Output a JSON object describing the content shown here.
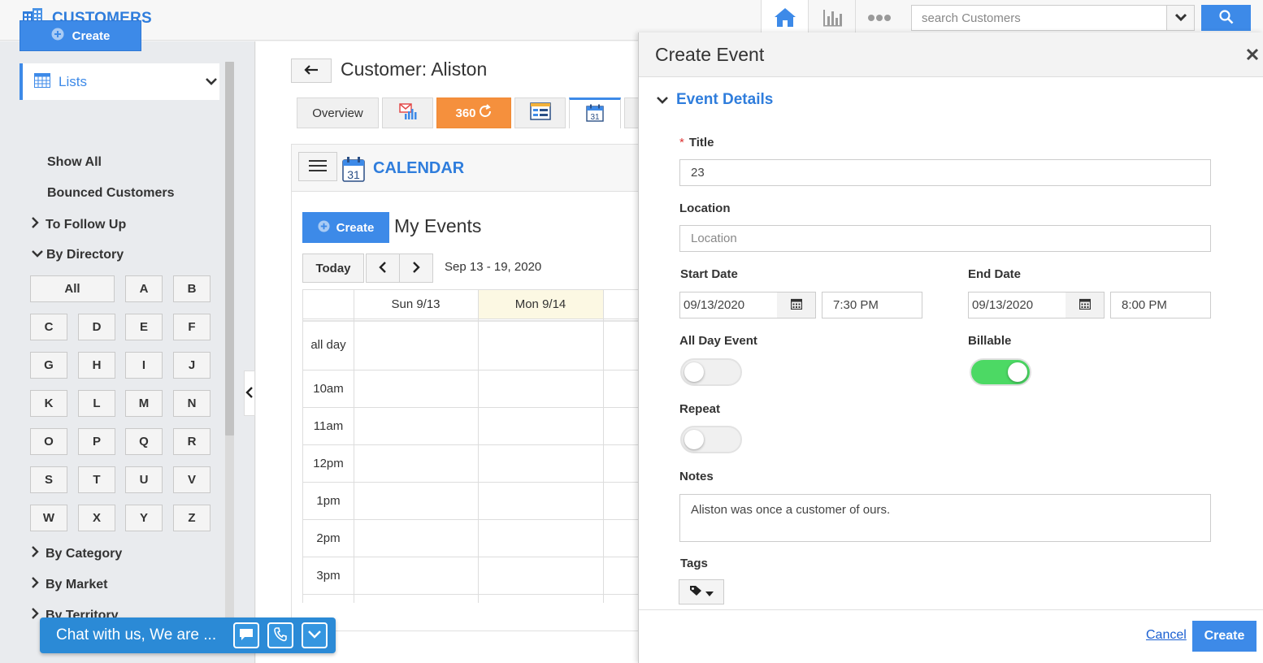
{
  "header": {
    "brand_title": "CUSTOMERS",
    "search_placeholder": "search Customers"
  },
  "sidebar": {
    "create_label": "Create",
    "lists_label": "Lists",
    "items": [
      "Show All",
      "Bounced Customers"
    ],
    "to_follow_up": "To Follow Up",
    "by_directory": "By Directory",
    "letters": [
      "All",
      "A",
      "B",
      "C",
      "D",
      "E",
      "F",
      "G",
      "H",
      "I",
      "J",
      "K",
      "L",
      "M",
      "N",
      "O",
      "P",
      "Q",
      "R",
      "S",
      "T",
      "U",
      "V",
      "W",
      "X",
      "Y",
      "Z"
    ],
    "by_category": "By Category",
    "by_market": "By Market",
    "by_territory": "By Territory"
  },
  "main": {
    "customer_title": "Customer: Aliston",
    "tabs": {
      "overview": "Overview",
      "three_sixty": "360"
    },
    "calendar_title": "CALENDAR",
    "create_label": "Create",
    "my_events": "My Events",
    "today": "Today",
    "date_range": "Sep 13 - 19, 2020",
    "days": [
      "Sun 9/13",
      "Mon 9/14"
    ],
    "all_day": "all day",
    "times": [
      "10am",
      "11am",
      "12pm",
      "1pm",
      "2pm",
      "3pm"
    ],
    "calendar_icon_day": "31"
  },
  "chat": {
    "text": "Chat with us, We are ..."
  },
  "modal": {
    "title": "Create Event",
    "section": "Event Details",
    "title_label": "Title",
    "title_value": "23",
    "location_label": "Location",
    "location_placeholder": "Location",
    "start_date_label": "Start Date",
    "start_date": "09/13/2020",
    "start_time": "7:30 PM",
    "end_date_label": "End Date",
    "end_date": "09/13/2020",
    "end_time": "8:00 PM",
    "all_day_label": "All Day Event",
    "billable_label": "Billable",
    "repeat_label": "Repeat",
    "notes_label": "Notes",
    "notes_value": "Aliston was once a customer of ours.",
    "tags_label": "Tags",
    "cancel_label": "Cancel",
    "create_label": "Create",
    "toggles": {
      "all_day": false,
      "billable": true,
      "repeat": false
    }
  },
  "colors": {
    "accent": "#3d8ae8",
    "brand": "#2f7ddc",
    "orange_tab": "#f5903d",
    "toggle_on": "#4cd964",
    "chat": "#2b8ad6"
  },
  "icons": [
    "building-icon",
    "home-icon",
    "bar-chart-icon",
    "more-icon",
    "chevron-down-icon",
    "search-icon",
    "plus-circle-icon",
    "table-icon",
    "chevron-right-icon",
    "back-arrow-icon",
    "email-chart-icon",
    "calendar-icon",
    "close-icon",
    "tag-icon",
    "chat-icon",
    "phone-icon"
  ]
}
